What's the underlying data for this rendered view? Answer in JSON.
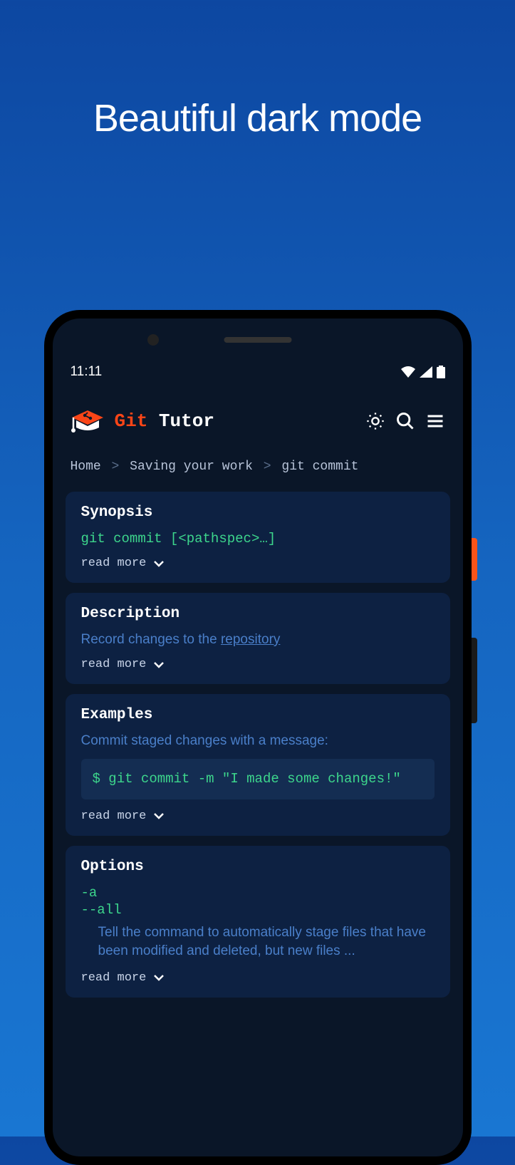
{
  "promo": {
    "title": "Beautiful dark mode"
  },
  "statusBar": {
    "time": "11:11"
  },
  "header": {
    "appName1": "Git",
    "appName2": "Tutor"
  },
  "breadcrumb": {
    "item1": "Home",
    "item2": "Saving your work",
    "item3": "git commit",
    "sep": ">"
  },
  "synopsis": {
    "title": "Synopsis",
    "code": "git commit [<pathspec>…]",
    "readMore": "read more"
  },
  "description": {
    "title": "Description",
    "text1": "Record changes to the ",
    "link": "repository",
    "readMore": "read more"
  },
  "examples": {
    "title": "Examples",
    "text": "Commit staged changes with a message:",
    "code": "$ git commit -m \"I made some changes!\"",
    "readMore": "read more"
  },
  "options": {
    "title": "Options",
    "flag1": "-a",
    "flag2": "--all",
    "desc": "Tell the command to automatically stage files that have been modified and deleted, but new files ...",
    "readMore": "read more"
  }
}
